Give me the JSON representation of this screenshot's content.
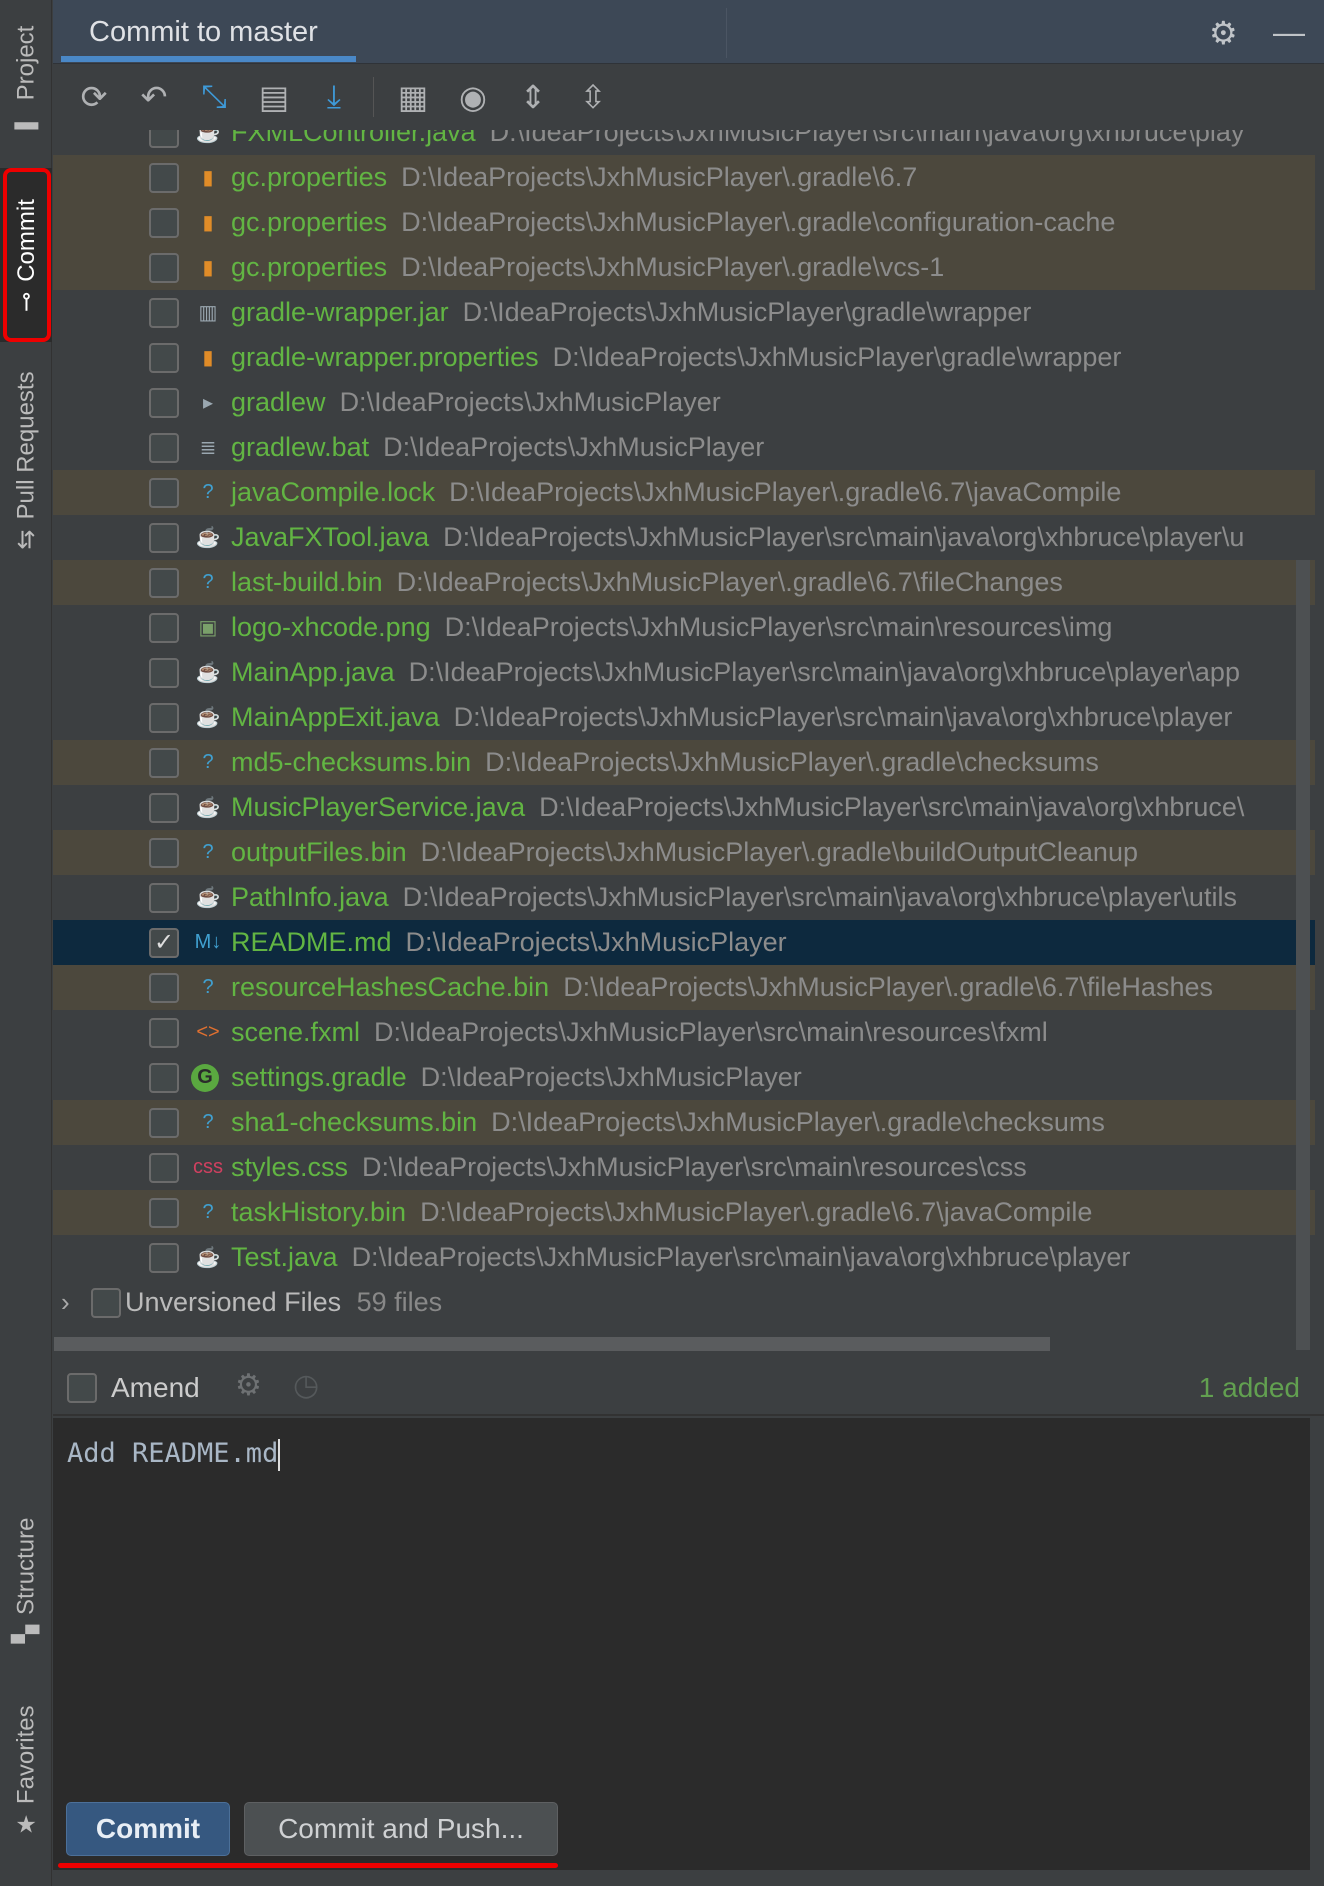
{
  "sidebar": {
    "tabs": [
      {
        "label": "Project"
      },
      {
        "label": "Commit",
        "active": true
      },
      {
        "label": "Pull Requests"
      },
      {
        "label": "Structure"
      },
      {
        "label": "Favorites"
      }
    ]
  },
  "header": {
    "title": "Commit to master"
  },
  "toolbar": {
    "icons": [
      "refresh-icon",
      "rollback-icon",
      "show-diff-icon",
      "shelve-icon",
      "update-icon",
      "group-by-icon",
      "view-options-icon",
      "expand-all-icon",
      "collapse-all-icon"
    ]
  },
  "files": [
    {
      "name": "FXMLController.java",
      "path": "D:\\IdeaProjects\\JxhMusicPlayer\\src\\main\\java\\org\\xhbruce\\play",
      "icon": "java",
      "ignored": false
    },
    {
      "name": "gc.properties",
      "path": "D:\\IdeaProjects\\JxhMusicPlayer\\.gradle\\6.7",
      "icon": "properties",
      "ignored": true
    },
    {
      "name": "gc.properties",
      "path": "D:\\IdeaProjects\\JxhMusicPlayer\\.gradle\\configuration-cache",
      "icon": "properties",
      "ignored": true
    },
    {
      "name": "gc.properties",
      "path": "D:\\IdeaProjects\\JxhMusicPlayer\\.gradle\\vcs-1",
      "icon": "properties",
      "ignored": true
    },
    {
      "name": "gradle-wrapper.jar",
      "path": "D:\\IdeaProjects\\JxhMusicPlayer\\gradle\\wrapper",
      "icon": "jar",
      "ignored": false
    },
    {
      "name": "gradle-wrapper.properties",
      "path": "D:\\IdeaProjects\\JxhMusicPlayer\\gradle\\wrapper",
      "icon": "properties",
      "ignored": false
    },
    {
      "name": "gradlew",
      "path": "D:\\IdeaProjects\\JxhMusicPlayer",
      "icon": "shell",
      "ignored": false
    },
    {
      "name": "gradlew.bat",
      "path": "D:\\IdeaProjects\\JxhMusicPlayer",
      "icon": "text",
      "ignored": false
    },
    {
      "name": "javaCompile.lock",
      "path": "D:\\IdeaProjects\\JxhMusicPlayer\\.gradle\\6.7\\javaCompile",
      "icon": "unknown",
      "ignored": true
    },
    {
      "name": "JavaFXTool.java",
      "path": "D:\\IdeaProjects\\JxhMusicPlayer\\src\\main\\java\\org\\xhbruce\\player\\u",
      "icon": "java",
      "ignored": false
    },
    {
      "name": "last-build.bin",
      "path": "D:\\IdeaProjects\\JxhMusicPlayer\\.gradle\\6.7\\fileChanges",
      "icon": "unknown",
      "ignored": true
    },
    {
      "name": "logo-xhcode.png",
      "path": "D:\\IdeaProjects\\JxhMusicPlayer\\src\\main\\resources\\img",
      "icon": "image",
      "ignored": false
    },
    {
      "name": "MainApp.java",
      "path": "D:\\IdeaProjects\\JxhMusicPlayer\\src\\main\\java\\org\\xhbruce\\player\\app",
      "icon": "java",
      "ignored": false
    },
    {
      "name": "MainAppExit.java",
      "path": "D:\\IdeaProjects\\JxhMusicPlayer\\src\\main\\java\\org\\xhbruce\\player",
      "icon": "java",
      "ignored": false
    },
    {
      "name": "md5-checksums.bin",
      "path": "D:\\IdeaProjects\\JxhMusicPlayer\\.gradle\\checksums",
      "icon": "unknown",
      "ignored": true
    },
    {
      "name": "MusicPlayerService.java",
      "path": "D:\\IdeaProjects\\JxhMusicPlayer\\src\\main\\java\\org\\xhbruce\\",
      "icon": "java",
      "ignored": false
    },
    {
      "name": "outputFiles.bin",
      "path": "D:\\IdeaProjects\\JxhMusicPlayer\\.gradle\\buildOutputCleanup",
      "icon": "unknown",
      "ignored": true
    },
    {
      "name": "PathInfo.java",
      "path": "D:\\IdeaProjects\\JxhMusicPlayer\\src\\main\\java\\org\\xhbruce\\player\\utils",
      "icon": "java",
      "ignored": false
    },
    {
      "name": "README.md",
      "path": "D:\\IdeaProjects\\JxhMusicPlayer",
      "icon": "markdown",
      "ignored": false,
      "checked": true,
      "selected": true
    },
    {
      "name": "resourceHashesCache.bin",
      "path": "D:\\IdeaProjects\\JxhMusicPlayer\\.gradle\\6.7\\fileHashes",
      "icon": "unknown",
      "ignored": true
    },
    {
      "name": "scene.fxml",
      "path": "D:\\IdeaProjects\\JxhMusicPlayer\\src\\main\\resources\\fxml",
      "icon": "xml",
      "ignored": false
    },
    {
      "name": "settings.gradle",
      "path": "D:\\IdeaProjects\\JxhMusicPlayer",
      "icon": "gradle",
      "ignored": false
    },
    {
      "name": "sha1-checksums.bin",
      "path": "D:\\IdeaProjects\\JxhMusicPlayer\\.gradle\\checksums",
      "icon": "unknown",
      "ignored": true
    },
    {
      "name": "styles.css",
      "path": "D:\\IdeaProjects\\JxhMusicPlayer\\src\\main\\resources\\css",
      "icon": "css",
      "ignored": false
    },
    {
      "name": "taskHistory.bin",
      "path": "D:\\IdeaProjects\\JxhMusicPlayer\\.gradle\\6.7\\javaCompile",
      "icon": "unknown",
      "ignored": true
    },
    {
      "name": "Test.java",
      "path": "D:\\IdeaProjects\\JxhMusicPlayer\\src\\main\\java\\org\\xhbruce\\player",
      "icon": "java",
      "ignored": false
    }
  ],
  "unversioned": {
    "label": "Unversioned Files",
    "count": "59 files"
  },
  "amend": {
    "label": "Amend",
    "checked": false,
    "status": "1 added"
  },
  "message": {
    "text": "Add README.md"
  },
  "buttons": {
    "commit": "Commit",
    "commit_push": "Commit and Push..."
  },
  "colors": {
    "added": "#62b543",
    "ignored_bg": "#4c483d",
    "selected_bg": "#0d293e",
    "accent": "#4a88c7",
    "annotation": "#e00000"
  }
}
